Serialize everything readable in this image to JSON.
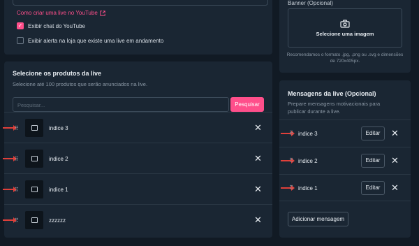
{
  "top": {
    "youtube_link": "Como criar uma live no YouTube",
    "checkbox_chat": "Exibir chat do YouTube",
    "checkbox_alert": "Exibir alerta na loja que existe uma live em andamento",
    "chat_checked": true,
    "alert_checked": false
  },
  "products": {
    "title": "Selecione os produtos da live",
    "subtitle": "Selecione até 100 produtos que serão anunciados na live.",
    "search_placeholder": "Pesquisar...",
    "search_button": "Pesquisar",
    "items": [
      {
        "name": "indice 3"
      },
      {
        "name": "indice 2"
      },
      {
        "name": "indice 1"
      },
      {
        "name": "zzzzzz"
      }
    ]
  },
  "banner": {
    "label": "Banner (Opcional)",
    "upload_label": "Selecione uma imagem",
    "note": "Recomendamos o formato .jpg, .png ou .svg e dimensões de 720x405px."
  },
  "messages": {
    "title": "Mensagens da live (Opcional)",
    "subtitle": "Prepare mensagens motivacionais para publicar durante a live.",
    "edit_label": "Editar",
    "add_button": "Adicionar mensagem",
    "items": [
      {
        "name": "indice 3"
      },
      {
        "name": "indice 2"
      },
      {
        "name": "indice 1"
      }
    ]
  },
  "colors": {
    "accent": "#ff4f8b",
    "annotation_arrow": "#e0403a",
    "card": "#1a2633",
    "background": "#111a24"
  }
}
